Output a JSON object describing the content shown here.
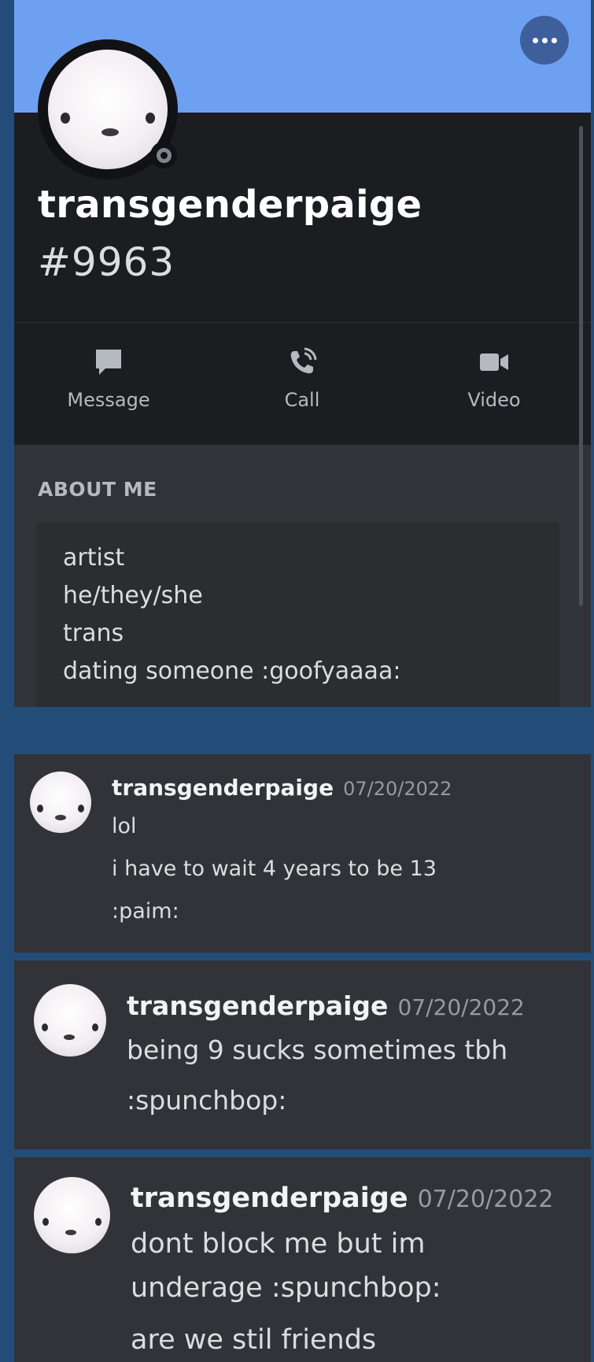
{
  "profile": {
    "username": "transgenderpaige",
    "discriminator": "#9963",
    "status": "offline",
    "more_label": "...",
    "actions": [
      {
        "label": "Message",
        "icon": "message-icon"
      },
      {
        "label": "Call",
        "icon": "call-icon"
      },
      {
        "label": "Video",
        "icon": "video-icon"
      }
    ],
    "about_title": "ABOUT ME",
    "about_lines": [
      "artist",
      "he/they/she",
      "trans",
      "dating someone :goofyaaaa:"
    ]
  },
  "messages": [
    {
      "author": "transgenderpaige",
      "timestamp": "07/20/2022",
      "lines": [
        "lol",
        "i have to wait 4 years to be 13",
        ":paim:"
      ]
    },
    {
      "author": "transgenderpaige",
      "timestamp": "07/20/2022",
      "lines": [
        "being 9 sucks sometimes tbh",
        ":spunchbop:"
      ]
    },
    {
      "author": "transgenderpaige",
      "timestamp": "07/20/2022",
      "lines": [
        "dont block me but im",
        "underage :spunchbop:",
        "are we stil friends"
      ]
    }
  ],
  "colors": {
    "banner": "#6ea0f2",
    "card_bg": "#1b1d21",
    "page_bg": "#234d78",
    "message_bg": "#313338"
  }
}
